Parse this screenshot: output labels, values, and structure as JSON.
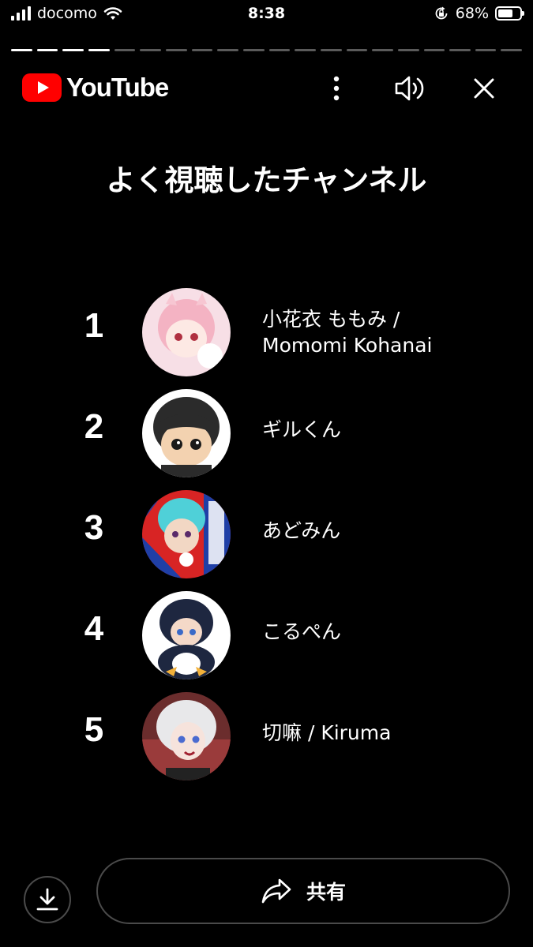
{
  "status_bar": {
    "carrier": "docomo",
    "time": "8:38",
    "battery_percent": "68%",
    "battery_level": 0.68
  },
  "story_progress": {
    "segments_total": 20,
    "segments_done": 4
  },
  "header": {
    "brand": "YouTube",
    "brand_color": "#FF0000",
    "icons": [
      "more-vert-icon",
      "volume-icon",
      "close-icon"
    ]
  },
  "title": "よく視聴したチャンネル",
  "channels": [
    {
      "rank": "1",
      "name_line1": "小花衣 ももみ /",
      "name_line2": "Momomi Kohanai",
      "avatar_colors": [
        "#f7dfe6",
        "#f4b3c3",
        "#ffffff"
      ]
    },
    {
      "rank": "2",
      "name_line1": "ギルくん",
      "name_line2": "",
      "avatar_colors": [
        "#ffffff",
        "#2b2b2b",
        "#f3d2b0"
      ]
    },
    {
      "rank": "3",
      "name_line1": "あどみん",
      "name_line2": "",
      "avatar_colors": [
        "#d82424",
        "#1f3fa6",
        "#4fd0d8"
      ]
    },
    {
      "rank": "4",
      "name_line1": "こるぺん",
      "name_line2": "",
      "avatar_colors": [
        "#ffffff",
        "#1e2740",
        "#f4d9c8"
      ]
    },
    {
      "rank": "5",
      "name_line1": "切嘛 / Kiruma",
      "name_line2": "",
      "avatar_colors": [
        "#6b2d2d",
        "#e8e8ea",
        "#9a3b3b"
      ]
    }
  ],
  "footer": {
    "share_label": "共有",
    "icons": [
      "download-icon",
      "share-icon"
    ]
  }
}
